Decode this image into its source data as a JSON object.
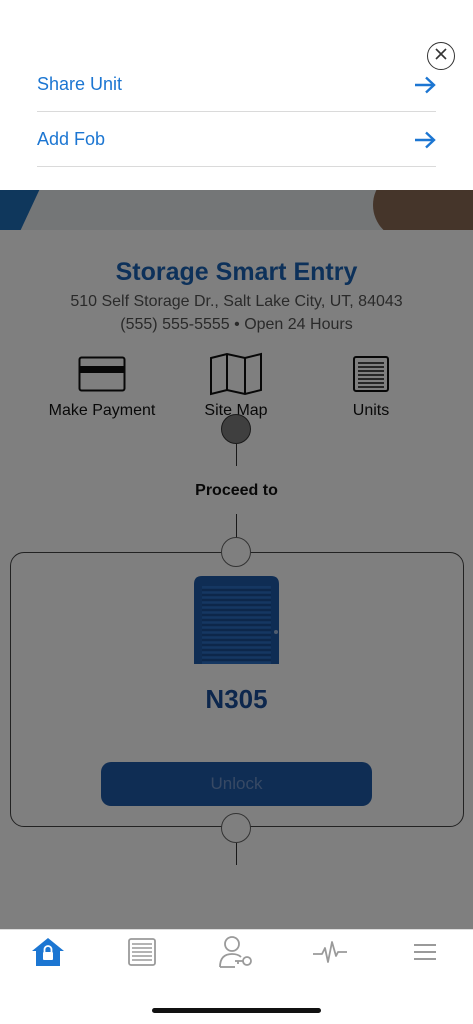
{
  "sheet": {
    "items": [
      {
        "label": "Share Unit",
        "icon": "arrow-right-icon"
      },
      {
        "label": "Add Fob",
        "icon": "arrow-right-icon"
      }
    ],
    "close_icon": "close-icon"
  },
  "site": {
    "name": "Storage Smart Entry",
    "address": "510 Self Storage Dr., Salt Lake City, UT, 84043",
    "phone_hours": "(555) 555-5555 • Open 24 Hours"
  },
  "quick_actions": [
    {
      "label": "Make Payment",
      "icon": "credit-card-icon"
    },
    {
      "label": "Site Map",
      "icon": "map-icon"
    },
    {
      "label": "Units",
      "icon": "storage-door-icon"
    }
  ],
  "proceed_label": "Proceed to",
  "unit": {
    "name": "N305",
    "unlock_label": "Unlock"
  },
  "tabs": [
    {
      "name": "home",
      "icon": "lock-home-icon",
      "active": true
    },
    {
      "name": "units",
      "icon": "storage-door-icon"
    },
    {
      "name": "access",
      "icon": "user-key-icon"
    },
    {
      "name": "activity",
      "icon": "activity-pulse-icon"
    },
    {
      "name": "menu",
      "icon": "hamburger-menu-icon"
    }
  ],
  "colors": {
    "accent": "#1c76d2",
    "brand": "#1b62b5",
    "tab_active": "#1c76d2"
  }
}
